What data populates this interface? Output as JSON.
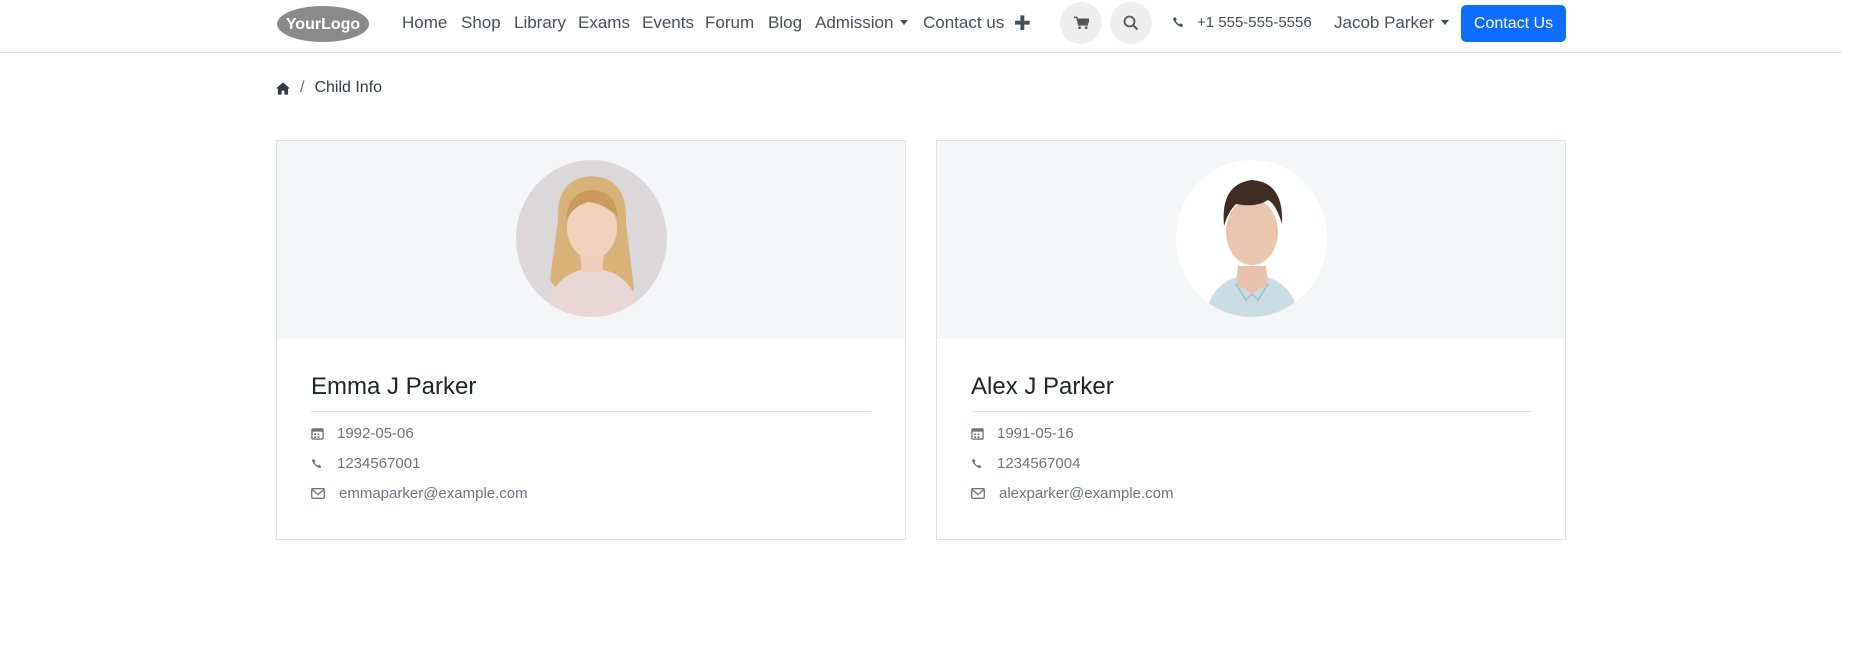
{
  "header": {
    "logo_text": "YourLogo",
    "nav": [
      "Home",
      "Shop",
      "Library",
      "Exams",
      "Events",
      "Forum",
      "Blog",
      "Admission",
      "Contact us"
    ],
    "phone": "+1 555-555-5556",
    "user": "Jacob Parker",
    "cta": "Contact Us",
    "accent_color": "#0d6efd"
  },
  "breadcrumb": {
    "current": "Child Info",
    "separator": "/"
  },
  "children": [
    {
      "name": "Emma J Parker",
      "dob": "1992-05-06",
      "phone": "1234567001",
      "email": "emmaparker@example.com"
    },
    {
      "name": "Alex J Parker",
      "dob": "1991-05-16",
      "phone": "1234567004",
      "email": "alexparker@example.com"
    }
  ]
}
